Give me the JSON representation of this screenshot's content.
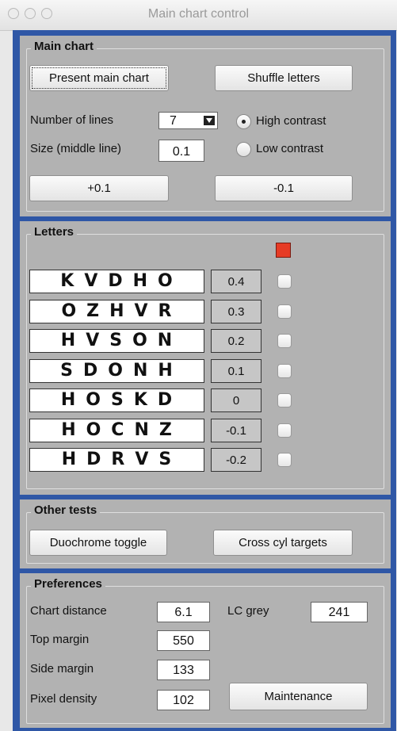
{
  "window": {
    "title": "Main chart control"
  },
  "main_chart": {
    "legend": "Main chart",
    "present_label": "Present main chart",
    "shuffle_label": "Shuffle letters",
    "number_of_lines_label": "Number of lines",
    "number_of_lines_value": "7",
    "size_label": "Size (middle line)",
    "size_value": "0.1",
    "high_contrast_label": "High contrast",
    "low_contrast_label": "Low contrast",
    "high_contrast_selected": true,
    "plus_label": "+0.1",
    "minus_label": "-0.1"
  },
  "letters": {
    "legend": "Letters",
    "indicator_color": "#e63b25",
    "rows": [
      {
        "letters": "KVDHO",
        "level": "0.4"
      },
      {
        "letters": "OZHVR",
        "level": "0.3"
      },
      {
        "letters": "HVSON",
        "level": "0.2"
      },
      {
        "letters": "SDONH",
        "level": "0.1"
      },
      {
        "letters": "HOSKD",
        "level": "0"
      },
      {
        "letters": "HOCNZ",
        "level": "-0.1"
      },
      {
        "letters": "HDRVS",
        "level": "-0.2"
      }
    ]
  },
  "other_tests": {
    "legend": "Other tests",
    "duochrome_label": "Duochrome toggle",
    "cross_cyl_label": "Cross cyl targets"
  },
  "preferences": {
    "legend": "Preferences",
    "chart_distance_label": "Chart distance",
    "chart_distance_value": "6.1",
    "lc_grey_label": "LC grey",
    "lc_grey_value": "241",
    "top_margin_label": "Top margin",
    "top_margin_value": "550",
    "side_margin_label": "Side margin",
    "side_margin_value": "133",
    "pixel_density_label": "Pixel density",
    "pixel_density_value": "102",
    "maintenance_label": "Maintenance"
  }
}
